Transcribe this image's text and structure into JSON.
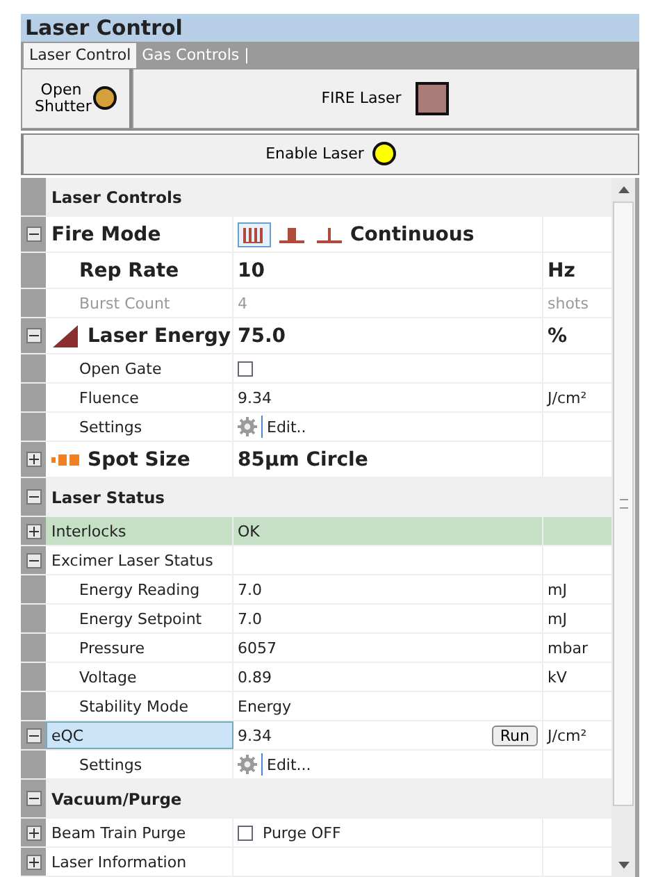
{
  "window": {
    "title": "Laser Control"
  },
  "tabs": [
    {
      "label": "Laser Control",
      "selected": true
    },
    {
      "label": "Gas Controls |",
      "selected": false
    }
  ],
  "buttons": [
    {
      "label": "Open Shutter",
      "kind": "circle",
      "color": "#d4a03c"
    },
    {
      "label": "FIRE Laser",
      "kind": "square",
      "color": "#a87b78"
    }
  ],
  "enable_button": {
    "label": "Enable Laser",
    "kind": "circle",
    "color": "#ffff00"
  },
  "sections": [
    {
      "label": "Laser Controls",
      "expanded": true,
      "rows": [
        {
          "kind": "mode",
          "name": "Fire Mode",
          "value": "Continuous",
          "expanded": true,
          "selected": false,
          "modes": [
            {
              "selected": true
            },
            {
              "selected": false
            },
            {
              "selected": false
            }
          ],
          "children": [
            {
              "kind": "large",
              "name": "Rep Rate",
              "value": "10",
              "unit": "Hz",
              "selected": false
            },
            {
              "kind": "normal",
              "name": "Burst Count",
              "value": "4",
              "unit": "shots",
              "disabled": true,
              "selected": false
            }
          ]
        },
        {
          "kind": "energy",
          "name": "Laser Energy",
          "value": "75.0",
          "unit": "%",
          "expanded": true,
          "selected": false,
          "children": [
            {
              "kind": "check",
              "name": "Open Gate",
              "checked": false,
              "selected": false
            },
            {
              "kind": "normal",
              "name": "Fluence",
              "value": "9.34",
              "unit": "J/cm²",
              "selected": false
            },
            {
              "kind": "settings",
              "name": "Settings",
              "value": "Edit..",
              "selected": false
            }
          ]
        },
        {
          "kind": "spot",
          "name": "Spot Size",
          "value": "85µm Circle",
          "expanded": false,
          "selected": false
        }
      ]
    },
    {
      "label": "Laser Status",
      "expanded": true,
      "rows": [
        {
          "kind": "normal",
          "name": "Interlocks",
          "value": "OK",
          "expanded": false,
          "highlight": true,
          "selected": false
        },
        {
          "kind": "normal",
          "name": "Excimer Laser Status",
          "expanded": true,
          "selected": false,
          "children": [
            {
              "kind": "normal",
              "name": "Energy Reading",
              "value": "7.0",
              "unit": "mJ",
              "selected": false
            },
            {
              "kind": "normal",
              "name": "Energy Setpoint",
              "value": "7.0",
              "unit": "mJ",
              "selected": false
            },
            {
              "kind": "normal",
              "name": "Pressure",
              "value": "6057",
              "unit": "mbar",
              "selected": false
            },
            {
              "kind": "normal",
              "name": "Voltage",
              "value": "0.89",
              "unit": "kV",
              "selected": false
            },
            {
              "kind": "normal",
              "name": "Stability Mode",
              "value": "Energy",
              "selected": false
            }
          ]
        },
        {
          "kind": "run",
          "name": "eQC",
          "value": "9.34",
          "button": "Run",
          "unit": "J/cm²",
          "expanded": true,
          "selected": true,
          "children": [
            {
              "kind": "settings",
              "name": "Settings",
              "value": "Edit...",
              "selected": false
            }
          ]
        }
      ]
    },
    {
      "label": "Vacuum/Purge",
      "expanded": true,
      "rows": [
        {
          "kind": "check",
          "name": "Beam Train Purge",
          "checked": false,
          "check_label": "Purge OFF",
          "expanded": false,
          "selected": false
        },
        {
          "kind": "normal",
          "name": "Laser Information",
          "expanded": false,
          "selected": false
        }
      ]
    }
  ]
}
